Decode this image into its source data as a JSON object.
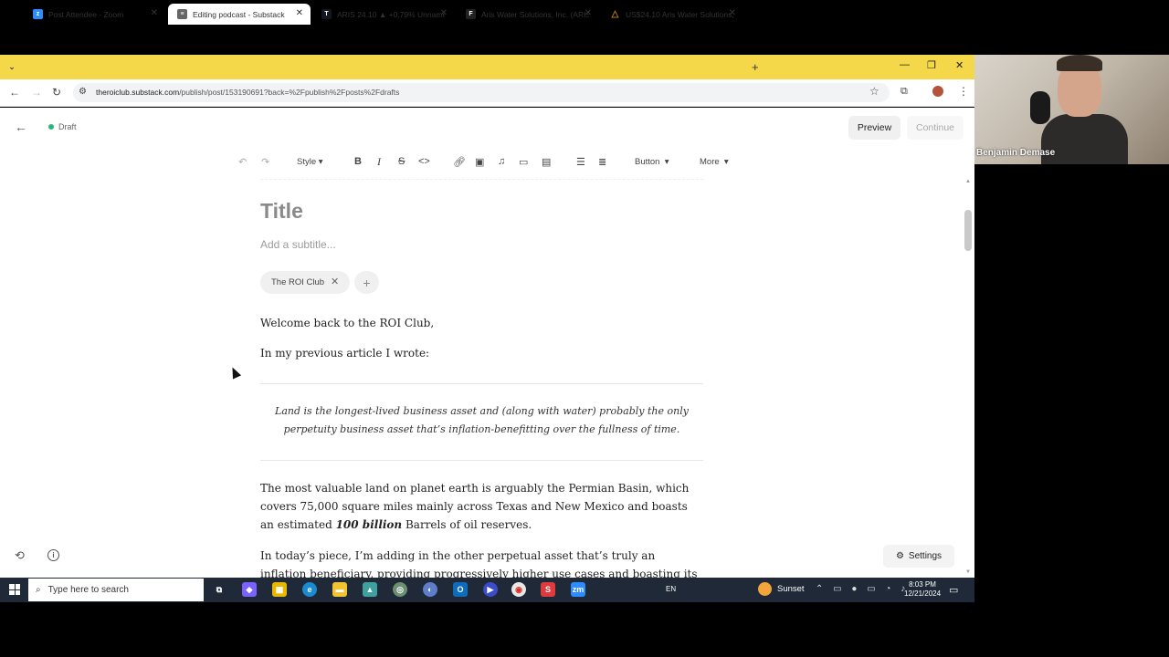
{
  "browser": {
    "tabs": [
      {
        "title": "Post Attendee - Zoom",
        "favicon": "zoom-icon",
        "active": false
      },
      {
        "title": "Editing podcast - Substack",
        "favicon": "substack-icon",
        "active": true
      },
      {
        "title": "ARIS 24.10 ▲ +0.79% Unname",
        "favicon": "tradingview-icon",
        "active": false
      },
      {
        "title": "Aris Water Solutions, Inc. (ARIS",
        "favicon": "finviz-icon",
        "active": false
      },
      {
        "title": "US$24.10 Aris Water Solutions,",
        "favicon": "simplywallst-icon",
        "active": false
      }
    ],
    "url_host": "theroiclub.substack.com",
    "url_path": "/publish/post/153190691?back=%2Fpublish%2Fposts%2Fdrafts"
  },
  "editor": {
    "status": "Draft",
    "preview_label": "Preview",
    "continue_label": "Continue",
    "toolbar": {
      "style_label": "Style",
      "button_label": "Button",
      "more_label": "More"
    },
    "title_placeholder": "Title",
    "subtitle_placeholder": "Add a subtitle...",
    "publication_chip": "The ROI Club",
    "paragraphs": {
      "p1": "Welcome back to the ROI Club,",
      "p2": "In my previous article I wrote:",
      "quote": "Land is the longest-lived business asset and (along with water) probably the only perpetuity business asset that’s inflation-benefitting over the fullness of time.",
      "p3_a": "The most valuable land on planet earth is arguably the Permian Basin, which covers 75,000 square miles mainly across Texas and New Mexico and boasts an estimated ",
      "p3_b": "100 billion",
      "p3_c": " Barrels of oil reserves.",
      "p4": "In today’s piece, I’m adding in the other perpetual asset that’s truly an inflation beneficiary, providing progressively higher use cases and boasting its own natural"
    },
    "settings_label": "Settings"
  },
  "zoom": {
    "speaker_name": "Benjamin Demase"
  },
  "taskbar": {
    "search_placeholder": "Type here to search",
    "language": "EN",
    "weather": "Sunset",
    "time": "8:03 PM",
    "date": "12/21/2024"
  },
  "colors": {
    "tab_bar": "#f5d84a",
    "draft_dot": "#2fb380",
    "taskbar": "#1f2937"
  }
}
